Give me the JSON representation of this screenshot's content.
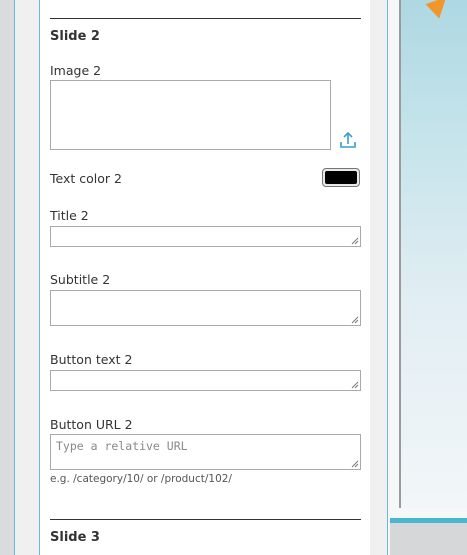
{
  "slide2": {
    "heading": "Slide 2",
    "image_label": "Image 2",
    "upload_icon": "upload-icon",
    "text_color_label": "Text color 2",
    "text_color_value": "#000000",
    "title_label": "Title 2",
    "title_value": "",
    "subtitle_label": "Subtitle 2",
    "subtitle_value": "",
    "button_text_label": "Button text 2",
    "button_text_value": "",
    "button_url_label": "Button URL 2",
    "button_url_placeholder": "Type a relative URL",
    "button_url_value": "",
    "button_url_help": "e.g. /category/10/ or /product/102/"
  },
  "slide3": {
    "heading": "Slide 3"
  },
  "colors": {
    "accent": "#49b6d0",
    "divider": "#333333",
    "preview_arrow": "#f0962a"
  }
}
